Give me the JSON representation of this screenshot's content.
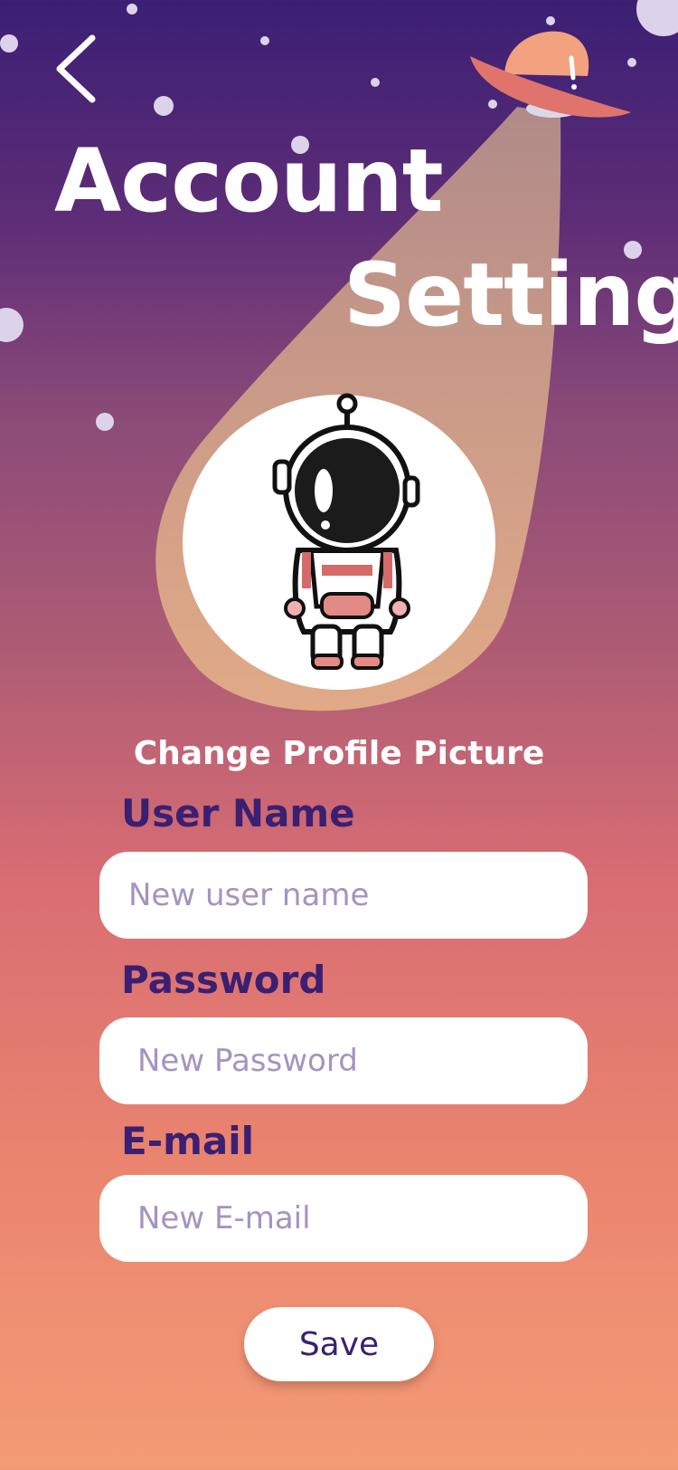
{
  "header": {
    "back_icon": "chevron-left-icon",
    "title_line1": "Account",
    "title_line2": "Setting"
  },
  "profile": {
    "avatar": "astronaut-avatar",
    "change_label": "Change Profile Picture"
  },
  "form": {
    "username": {
      "label": "User Name",
      "placeholder": "New user name",
      "value": ""
    },
    "password": {
      "label": "Password",
      "placeholder": "New Password",
      "value": ""
    },
    "email": {
      "label": "E-mail",
      "placeholder": "New E-mail",
      "value": ""
    }
  },
  "actions": {
    "save_label": "Save"
  },
  "colors": {
    "accent": "#3a1f72",
    "beam": "#d9a98a",
    "ufo": "#f09a7f"
  }
}
